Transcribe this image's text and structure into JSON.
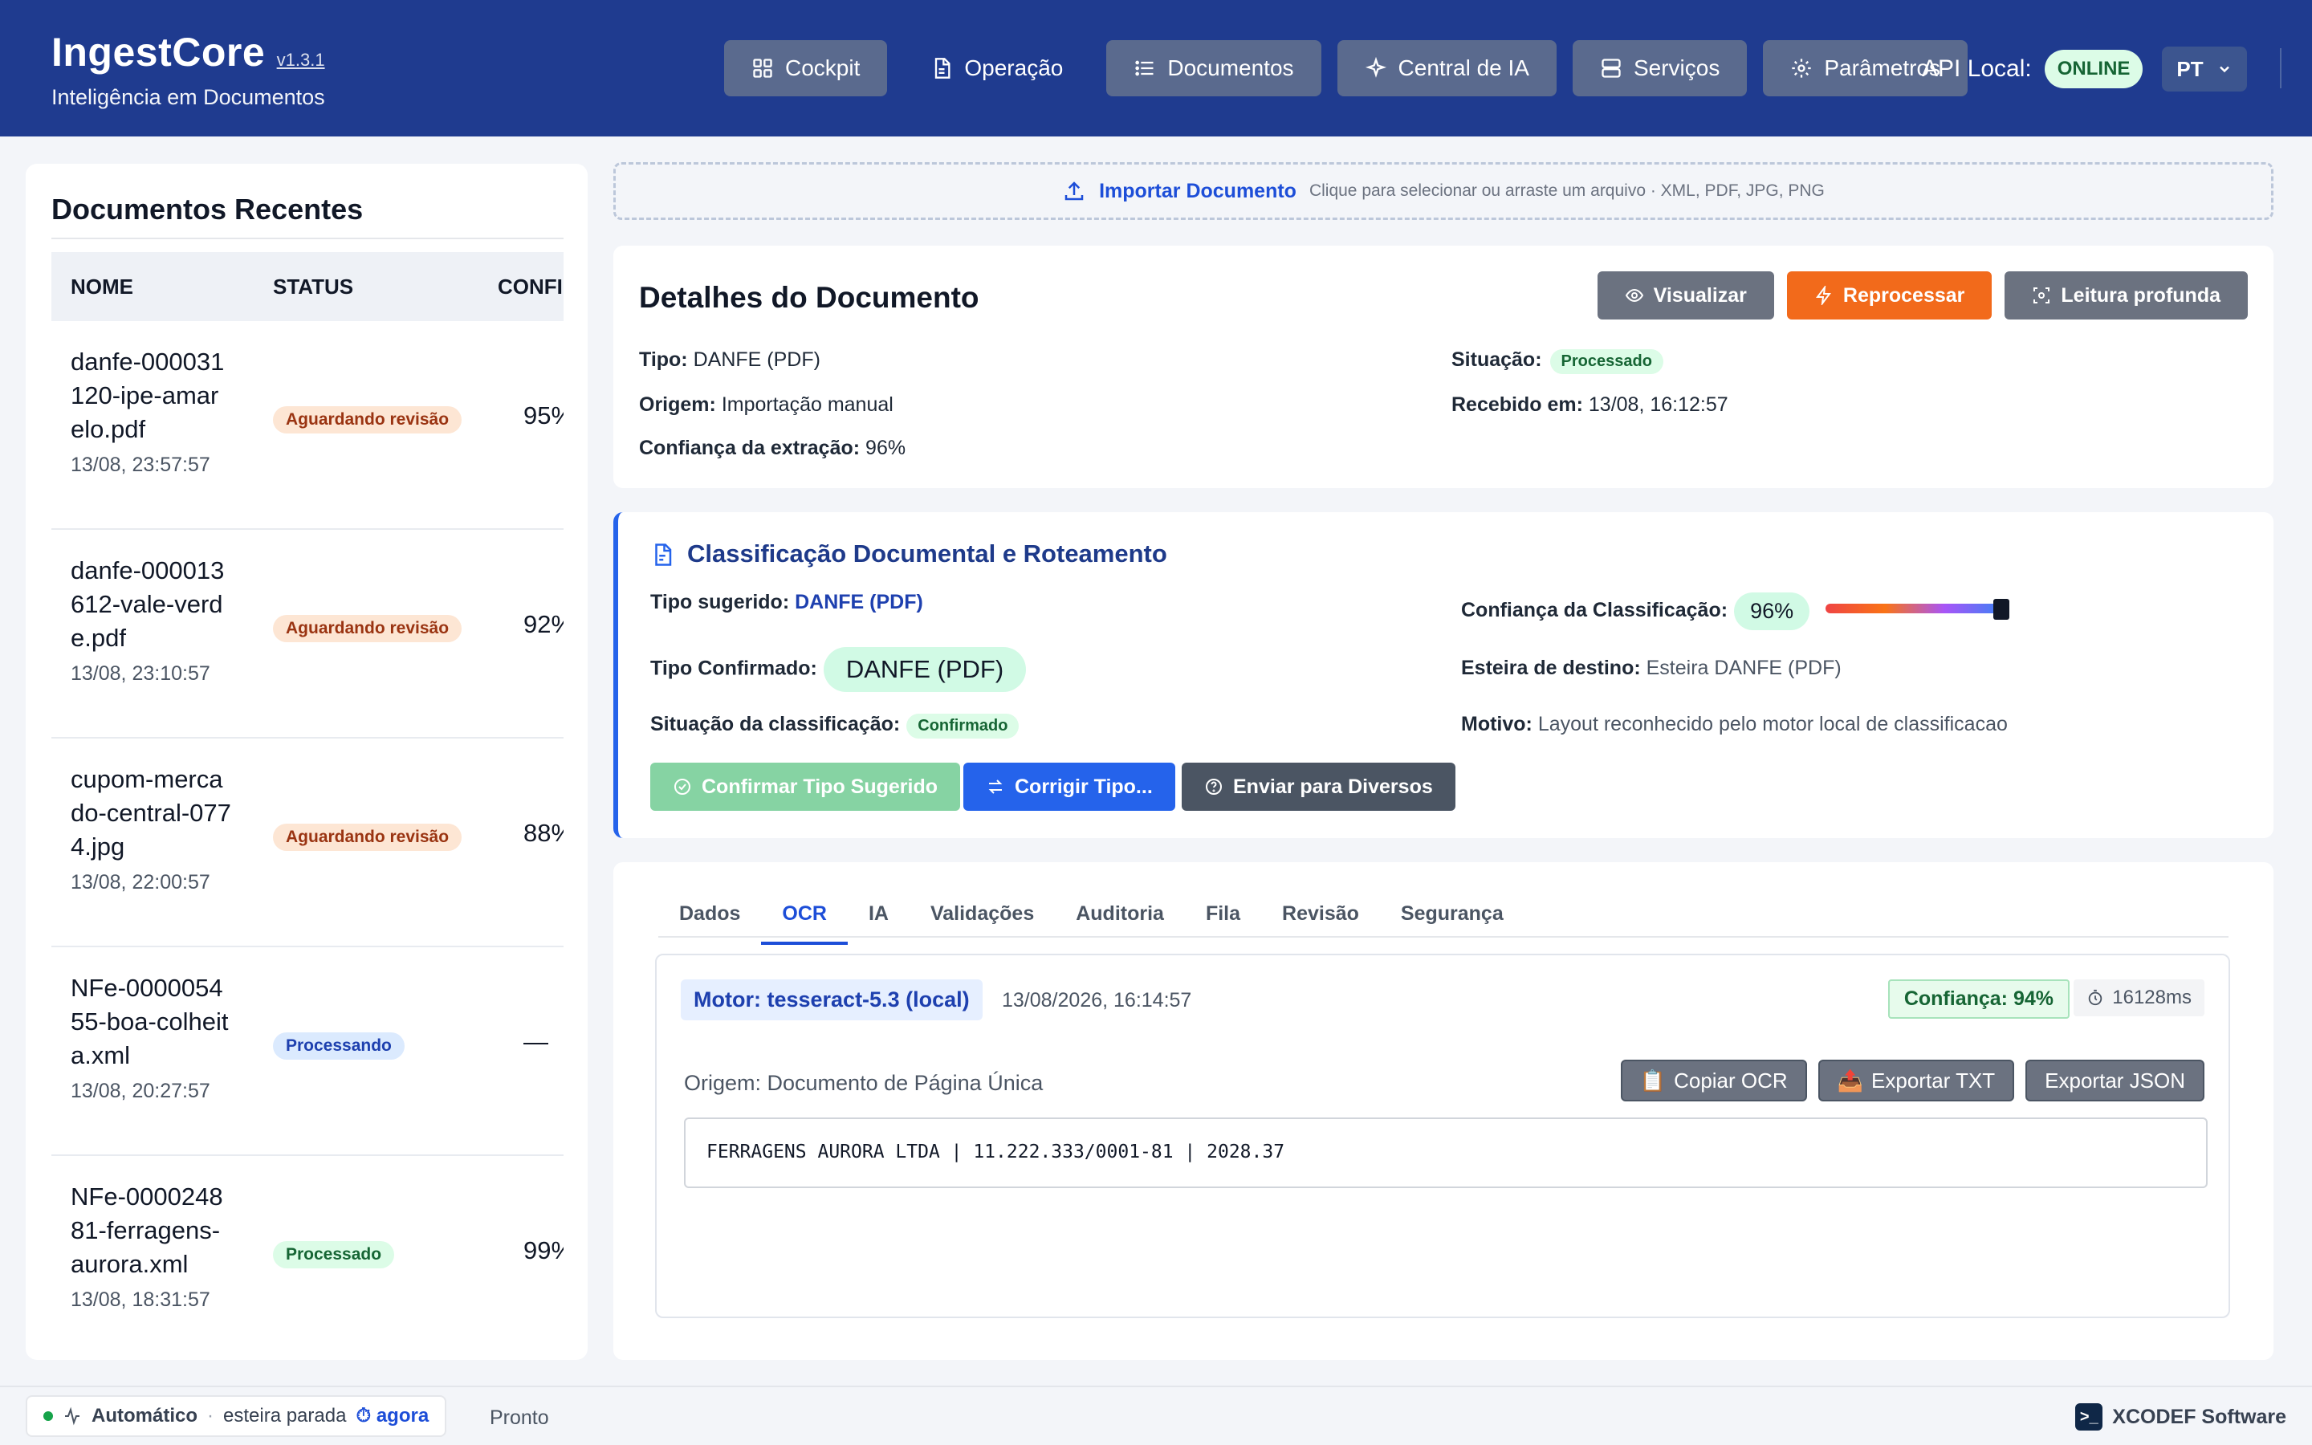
{
  "app": {
    "name": "IngestCore",
    "version": "v1.3.1",
    "tagline": "Inteligência em Documentos"
  },
  "nav": [
    {
      "label": "Cockpit",
      "icon": "grid-icon"
    },
    {
      "label": "Operação",
      "icon": "document-icon"
    },
    {
      "label": "Documentos",
      "icon": "list-icon"
    },
    {
      "label": "Central de IA",
      "icon": "sparkle-icon"
    },
    {
      "label": "Serviços",
      "icon": "server-icon"
    },
    {
      "label": "Parâmetros",
      "icon": "gear-icon"
    }
  ],
  "api": {
    "label": "API Local:",
    "status": "ONLINE"
  },
  "language": "PT",
  "recent": {
    "title": "Documentos Recentes",
    "columns": [
      "NOME",
      "STATUS",
      "CONFI"
    ],
    "rows": [
      {
        "name": "danfe-000031120-ipe-amarelo.pdf",
        "date": "13/08, 23:57:57",
        "status": "Aguardando revisão",
        "status_kind": "wait",
        "conf": "95%"
      },
      {
        "name": "danfe-000013612-vale-verde.pdf",
        "date": "13/08, 23:10:57",
        "status": "Aguardando revisão",
        "status_kind": "wait",
        "conf": "92%"
      },
      {
        "name": "cupom-mercado-central-0774.jpg",
        "date": "13/08, 22:00:57",
        "status": "Aguardando revisão",
        "status_kind": "wait",
        "conf": "88%"
      },
      {
        "name": "NFe-000005455-boa-colheita.xml",
        "date": "13/08, 20:27:57",
        "status": "Processando",
        "status_kind": "proc",
        "conf": "—"
      },
      {
        "name": "NFe-000024881-ferragens-aurora.xml",
        "date": "13/08, 18:31:57",
        "status": "Processado",
        "status_kind": "done",
        "conf": "99%"
      }
    ]
  },
  "import": {
    "title": "Importar Documento",
    "subtitle": "Clique para selecionar ou arraste um arquivo · XML, PDF, JPG, PNG"
  },
  "details": {
    "title": "Detalhes do Documento",
    "actions": {
      "view": "Visualizar",
      "reprocess": "Reprocessar",
      "deep": "Leitura profunda"
    },
    "tipo_label": "Tipo:",
    "tipo": "DANFE (PDF)",
    "origem_label": "Origem:",
    "origem": "Importação manual",
    "confianca_label": "Confiança da extração:",
    "confianca": "96%",
    "situacao_label": "Situação:",
    "situacao": "Processado",
    "recebido_label": "Recebido em:",
    "recebido": "13/08, 16:12:57"
  },
  "classification": {
    "title": "Classificação Documental e Roteamento",
    "sugerido_label": "Tipo sugerido:",
    "sugerido": "DANFE (PDF)",
    "confirmado_label": "Tipo Confirmado:",
    "confirmado": "DANFE (PDF)",
    "situacao_label": "Situação da classificação:",
    "situacao": "Confirmado",
    "conf_label": "Confiança da Classificação:",
    "conf": "96%",
    "conf_value": 0.96,
    "esteira_label": "Esteira de destino:",
    "esteira": "Esteira DANFE (PDF)",
    "motivo_label": "Motivo:",
    "motivo": "Layout reconhecido pelo motor local de classificacao",
    "buttons": {
      "confirm": "Confirmar Tipo Sugerido",
      "fix": "Corrigir Tipo...",
      "send": "Enviar para Diversos"
    }
  },
  "tabs": [
    "Dados",
    "OCR",
    "IA",
    "Validações",
    "Auditoria",
    "Fila",
    "Revisão",
    "Segurança"
  ],
  "active_tab": "OCR",
  "ocr": {
    "engine": "Motor: tesseract-5.3 (local)",
    "timestamp": "13/08/2026, 16:14:57",
    "confidence": "Confiança: 94%",
    "duration": "16128ms",
    "origin": "Origem: Documento de Página Única",
    "actions": {
      "copy": "Copiar OCR",
      "txt": "Exportar TXT",
      "json": "Exportar JSON"
    },
    "text": "FERRAGENS AURORA LTDA | 11.222.333/0001-81 | 2028.37"
  },
  "footer": {
    "mode": "Automático",
    "conveyor": "esteira parada",
    "when": "agora",
    "state": "Pronto",
    "vendor": "XCODEF Software"
  }
}
